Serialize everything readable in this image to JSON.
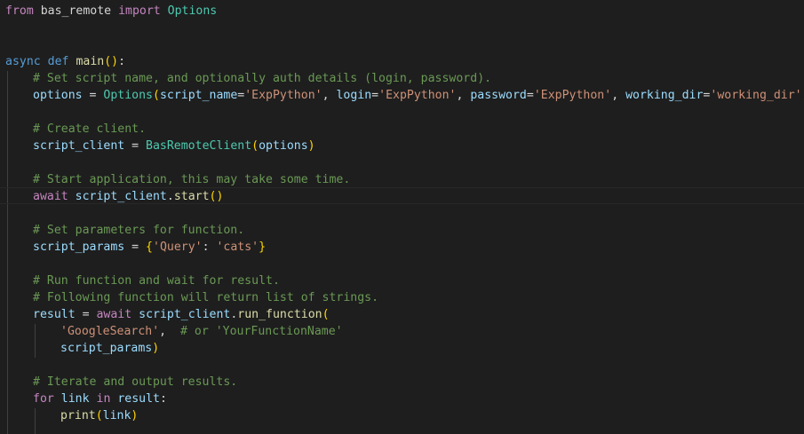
{
  "editor": {
    "language": "python",
    "theme_colors": {
      "background": "#1e1e1e",
      "keyword": "#569cd6",
      "control": "#c586c0",
      "function": "#dcdcaa",
      "class": "#4ec9b0",
      "variable": "#9cdcfe",
      "string": "#ce9178",
      "comment": "#6a9955",
      "bracket_level1": "#ffd700",
      "bracket_level2": "#da70d6"
    },
    "lines": {
      "l1": {
        "kw_from": "from",
        "module": "bas_remote",
        "kw_import": "import",
        "name": "Options"
      },
      "l4": {
        "kw_async": "async",
        "kw_def": "def",
        "fn": "main",
        "paren_open": "(",
        "paren_close": ")",
        "colon": ":"
      },
      "l5": {
        "comment": "# Set script name, and optionally auth details (login, password)."
      },
      "l6": {
        "var": "options",
        "eq": " = ",
        "cls": "Options",
        "p1": "(",
        "arg1": "script_name",
        "eq1": "=",
        "val1": "'ExpPython'",
        "sep1": ", ",
        "arg2": "login",
        "eq2": "=",
        "val2": "'ExpPython'",
        "sep2": ", ",
        "arg3": "password",
        "eq3": "=",
        "val3": "'ExpPython'",
        "sep3": ", ",
        "arg4": "working_dir",
        "eq4": "=",
        "val4": "'working_dir'",
        "p2": ")"
      },
      "l8": {
        "comment": "# Create client."
      },
      "l9": {
        "var": "script_client",
        "eq": " = ",
        "cls": "BasRemoteClient",
        "p1": "(",
        "arg": "options",
        "p2": ")"
      },
      "l11": {
        "comment": "# Start application, this may take some time."
      },
      "l12": {
        "kw_await": "await",
        "obj": "script_client",
        "dot": ".",
        "fn": "start",
        "p1": "(",
        "p2": ")"
      },
      "l14": {
        "comment": "# Set parameters for function."
      },
      "l15": {
        "var": "script_params",
        "eq": " = ",
        "b1": "{",
        "key": "'Query'",
        "colon": ": ",
        "val": "'cats'",
        "b2": "}"
      },
      "l17": {
        "comment": "# Run function and wait for result."
      },
      "l18": {
        "comment": "# Following function will return list of strings."
      },
      "l19": {
        "var": "result",
        "eq": " = ",
        "kw_await": "await",
        "obj": "script_client",
        "dot": ".",
        "fn": "run_function",
        "p1": "("
      },
      "l20": {
        "str": "'GoogleSearch'",
        "comma": ",",
        "comment": "# or 'YourFunctionName'"
      },
      "l21": {
        "var": "script_params",
        "p2": ")"
      },
      "l23": {
        "comment": "# Iterate and output results."
      },
      "l24": {
        "kw_for": "for",
        "var": "link",
        "kw_in": "in",
        "iter": "result",
        "colon": ":"
      },
      "l25": {
        "fn": "print",
        "p1": "(",
        "arg": "link",
        "p2": ")"
      }
    }
  }
}
